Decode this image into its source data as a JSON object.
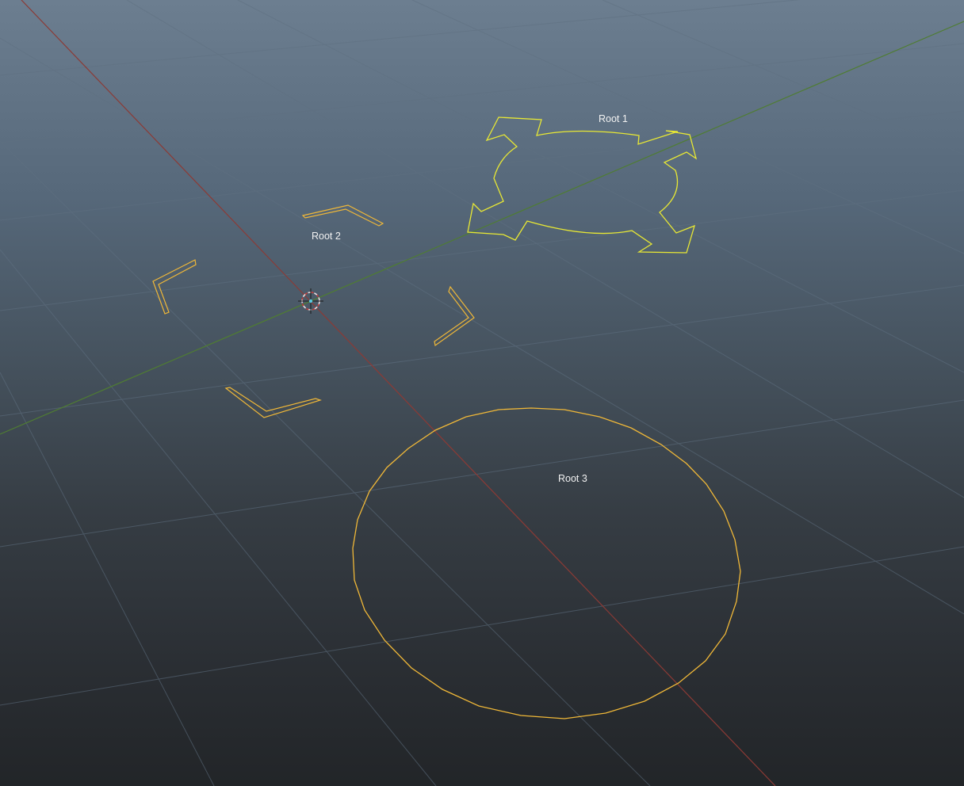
{
  "viewport": {
    "name": "3D viewport",
    "colors": {
      "background_top": "#6c7e90",
      "background_bottom": "#222528",
      "grid": "#5f7081",
      "x_axis": "#8c3a35",
      "z_axis": "#4f7d32",
      "selected_curve": "#e8e834",
      "curve": "#f0b838",
      "label": "#f2f2f2"
    }
  },
  "objects": [
    {
      "id": "root1",
      "label": "Root 1",
      "shape": "four-way-arrow-control",
      "color": "#e8e834"
    },
    {
      "id": "root2",
      "label": "Root 2",
      "shape": "corner-brackets-control",
      "color": "#f0b838"
    },
    {
      "id": "root3",
      "label": "Root 3",
      "shape": "circle-control",
      "color": "#f0b838"
    }
  ],
  "pivot": {
    "icon": "pivot-manipulator-icon"
  }
}
